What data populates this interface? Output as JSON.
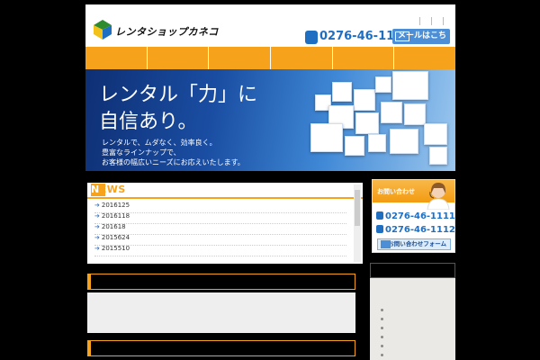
{
  "header": {
    "logo_text": "レンタショップカネコ",
    "phone": "0276-46-1111",
    "mail_button_label": "メールはこちら"
  },
  "nav": {
    "items": [
      "",
      "",
      "",
      "",
      "",
      ""
    ]
  },
  "banner": {
    "title_line1": "レンタル「力」に",
    "title_line2": "自信あり。",
    "description": [
      "レンタルで、ムダなく、効率良く。",
      "豊富なラインナップで、",
      "お客様の幅広いニーズにお応えいたします。"
    ]
  },
  "news": {
    "title": "NEWS",
    "items": [
      "2016125",
      "2016118",
      "201618",
      "2015624",
      "2015510"
    ]
  },
  "contact": {
    "heading": "お問い合わせ",
    "phone1": "0276-46-1111",
    "phone2": "0276-46-1112",
    "form_button_label": "お問い合わせフォーム"
  },
  "colors": {
    "accent": "#f6a31b",
    "brand_blue": "#1e6fc2",
    "background": "#000000"
  }
}
